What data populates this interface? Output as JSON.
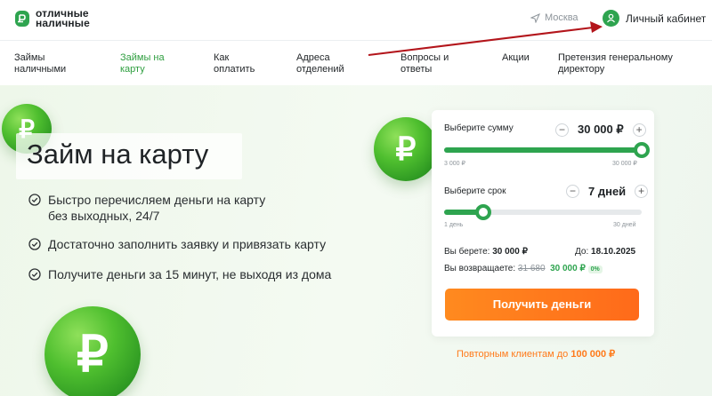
{
  "brand": {
    "line1": "отличные",
    "line2": "наличные"
  },
  "header": {
    "city": "Москва",
    "cabinet": "Личный кабинет"
  },
  "nav": [
    {
      "label_1": "Займы",
      "label_2": "наличными",
      "active": false
    },
    {
      "label_1": "Займы на",
      "label_2": "карту",
      "active": true
    },
    {
      "label_1": "Как",
      "label_2": "оплатить",
      "active": false
    },
    {
      "label_1": "Адреса",
      "label_2": "отделений",
      "active": false
    },
    {
      "label_1": "Вопросы и",
      "label_2": "ответы",
      "active": false
    },
    {
      "label_1": "Акции",
      "label_2": "",
      "active": false
    },
    {
      "label_1": "Претензия генеральному",
      "label_2": "директору",
      "active": false
    }
  ],
  "hero": {
    "title": "Займ на карту",
    "features": [
      {
        "line1": "Быстро перечисляем деньги на карту",
        "line2": "без выходных, 24/7"
      },
      {
        "line1": "Достаточно заполнить заявку и привязать карту",
        "line2": ""
      },
      {
        "line1": "Получите деньги за 15 минут, не выходя из дома",
        "line2": ""
      }
    ],
    "coin_symbol": "₽"
  },
  "calculator": {
    "amount": {
      "label": "Выберите сумму",
      "value": "30 000 ₽",
      "min": "3 000 ₽",
      "max": "30 000 ₽",
      "level": 1.0,
      "minus": "−",
      "plus": "+"
    },
    "term": {
      "label": "Выберите срок",
      "value": "7 дней",
      "min": "1 день",
      "max": "30 дней",
      "level": 0.2,
      "minus": "−",
      "plus": "+"
    },
    "take_label": "Вы берете:",
    "take_value": "30 000 ₽",
    "until_label": "До:",
    "until_value": "18.10.2025",
    "return_label": "Вы возвращаете:",
    "return_old": "31 680",
    "return_new": "30 000 ₽",
    "return_badge": "0%",
    "cta": "Получить деньги"
  },
  "repeat": {
    "text": "Повторным клиентам до",
    "amount": "100 000 ₽"
  },
  "colors": {
    "accent": "#2ea44f",
    "cta": "#ff7a1a",
    "arrow": "#b3151b"
  }
}
